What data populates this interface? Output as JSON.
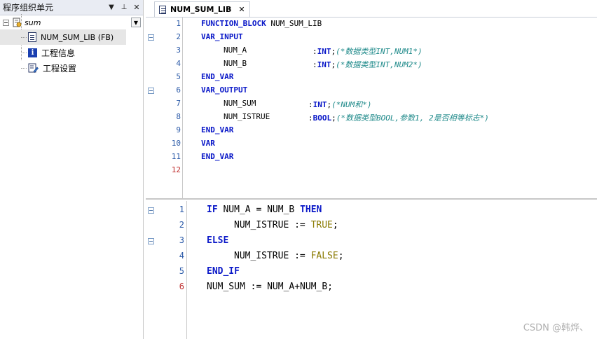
{
  "left_panel": {
    "title": "程序组织单元",
    "buttons": {
      "menu": "▼",
      "pin": "⊥",
      "close": "✕"
    },
    "tree": {
      "root_label": "sum",
      "dropdown": "▼",
      "items": [
        {
          "label": "NUM_SUM_LIB (FB)",
          "icon": "document-icon"
        },
        {
          "label": "工程信息",
          "icon": "info-icon"
        },
        {
          "label": "工程设置",
          "icon": "settings-icon"
        }
      ]
    }
  },
  "editor": {
    "tab": {
      "label": "NUM_SUM_LIB",
      "close": "✕"
    },
    "declaration": {
      "lines": [
        {
          "num": "1"
        },
        {
          "num": "2"
        },
        {
          "num": "3"
        },
        {
          "num": "4"
        },
        {
          "num": "5"
        },
        {
          "num": "6"
        },
        {
          "num": "7"
        },
        {
          "num": "8"
        },
        {
          "num": "9"
        },
        {
          "num": "10"
        },
        {
          "num": "11"
        },
        {
          "num": "12"
        }
      ],
      "text": {
        "l1_kw": "FUNCTION_BLOCK",
        "l1_name": " NUM_SUM_LIB",
        "l2_kw": "VAR_INPUT",
        "l3_var": "NUM_A",
        "l3_colon": ":",
        "l3_type": "INT",
        "l3_semi": ";",
        "l3_cmt": "(*数据类型INT,NUM1*)",
        "l4_var": "NUM_B",
        "l4_colon": ":",
        "l4_type": "INT",
        "l4_semi": ";",
        "l4_cmt": "(*数据类型INT,NUM2*)",
        "l5_kw": "END_VAR",
        "l6_kw": "VAR_OUTPUT",
        "l7_var": "NUM_SUM",
        "l7_colon": ":",
        "l7_type": "INT",
        "l7_semi": ";",
        "l7_cmt": "(*NUM和*)",
        "l8_var": "NUM_ISTRUE",
        "l8_colon": ":",
        "l8_type": "BOOL",
        "l8_semi": ";",
        "l8_cmt": "(*数据类型BOOL,参数1, 2是否相等标志*)",
        "l9_kw": "END_VAR",
        "l10_kw": "VAR",
        "l11_kw": "END_VAR"
      }
    },
    "implementation": {
      "lines": [
        {
          "num": "1"
        },
        {
          "num": "2"
        },
        {
          "num": "3"
        },
        {
          "num": "4"
        },
        {
          "num": "5"
        },
        {
          "num": "6"
        }
      ],
      "text": {
        "l1_if": "IF",
        "l1_expr": " NUM_A = NUM_B ",
        "l1_then": "THEN",
        "l2_assign": "NUM_ISTRUE := ",
        "l2_val": "TRUE",
        "l2_semi": ";",
        "l3_else": "ELSE",
        "l4_assign": "NUM_ISTRUE := ",
        "l4_val": "FALSE",
        "l4_semi": ";",
        "l5_endif": "END_IF",
        "l6_stmt": "NUM_SUM := NUM_A+NUM_B;"
      }
    }
  },
  "watermark": "CSDN @韩烨、",
  "colors": {
    "keyword": "#0a18c8",
    "literal": "#8a7a00",
    "comment": "#1f8a8a",
    "line_number": "#2b5aa8",
    "line_number_last": "#c03030"
  }
}
